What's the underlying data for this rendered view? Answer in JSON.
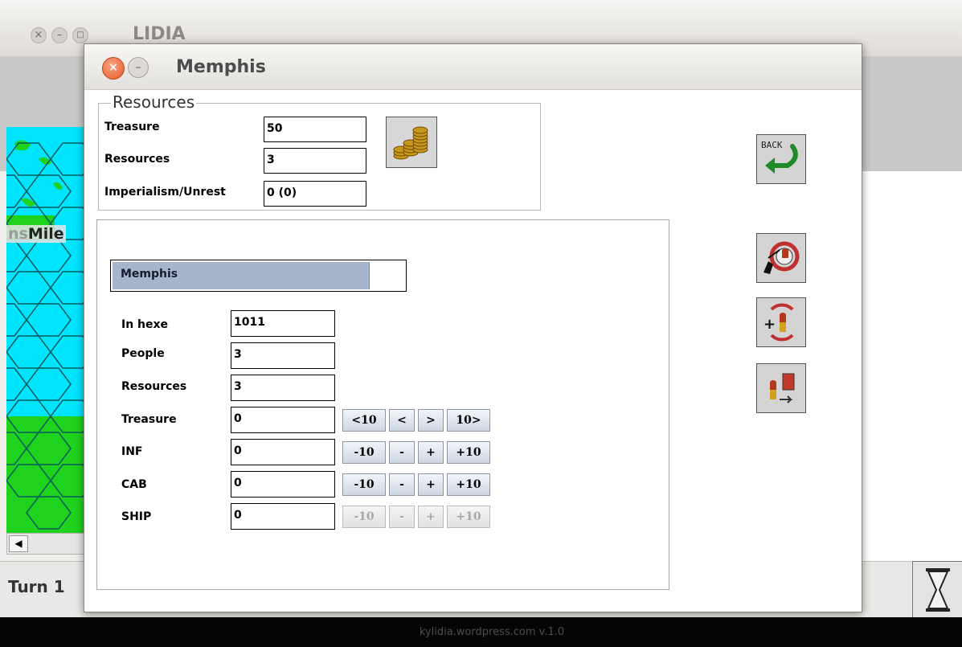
{
  "main_window": {
    "title": "LIDIA",
    "map_label_partial": "ns",
    "map_label": "Mile",
    "turn_label": "Turn 1",
    "footer": "kylidia.wordpress.com v.1.0"
  },
  "dialog": {
    "title": "Memphis",
    "resources_group": {
      "legend": "Resources",
      "rows": [
        {
          "label": "Treasure",
          "value": "50"
        },
        {
          "label": "Resources",
          "value": "3"
        },
        {
          "label": "Imperialism/Unrest",
          "value": "0 (0)"
        }
      ]
    },
    "city": {
      "name": "Memphis",
      "progress": 0.88,
      "fields": [
        {
          "label": "In hexe",
          "value": "1011"
        },
        {
          "label": "People",
          "value": "3"
        },
        {
          "label": "Resources",
          "value": "3"
        },
        {
          "label": "Treasure",
          "value": "0"
        },
        {
          "label": "INF",
          "value": "0"
        },
        {
          "label": "CAB",
          "value": "0"
        },
        {
          "label": "SHIP",
          "value": "0"
        }
      ],
      "treasure_buttons": [
        "<10",
        "<",
        ">",
        "10>"
      ],
      "unit_buttons": [
        "-10",
        "-",
        "+",
        "+10"
      ]
    },
    "side_buttons": {
      "back_label": "BACK"
    }
  },
  "colors": {
    "accent": "#e8592a",
    "city_bar": "#a4b5cc",
    "map_water": "#00e5ff",
    "map_land": "#1ed21e"
  }
}
